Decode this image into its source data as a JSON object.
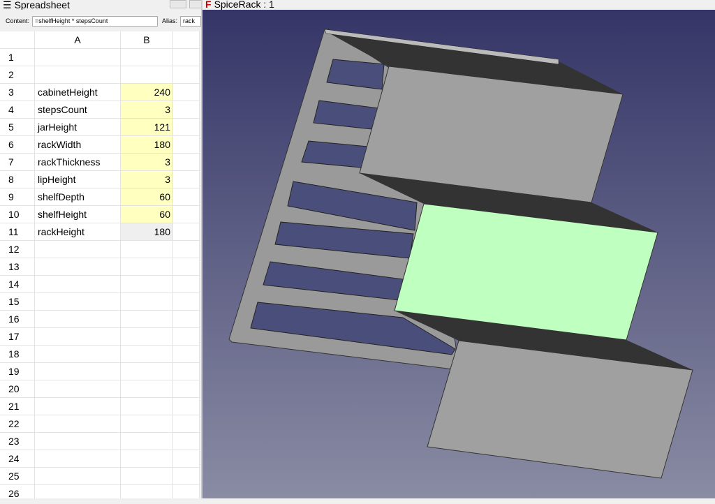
{
  "spreadsheet": {
    "title": "Spreadsheet",
    "content_label": "Content:",
    "content_value": "=shelfHeight * stepsCount",
    "alias_label": "Alias:",
    "alias_value": "rack",
    "columns": [
      "A",
      "B"
    ],
    "rows": [
      {
        "n": "1",
        "a": "",
        "b": ""
      },
      {
        "n": "2",
        "a": "",
        "b": ""
      },
      {
        "n": "3",
        "a": "cabinetHeight",
        "b": "240"
      },
      {
        "n": "4",
        "a": "stepsCount",
        "b": "3"
      },
      {
        "n": "5",
        "a": "jarHeight",
        "b": "121"
      },
      {
        "n": "6",
        "a": "rackWidth",
        "b": "180"
      },
      {
        "n": "7",
        "a": "rackThickness",
        "b": "3"
      },
      {
        "n": "8",
        "a": "lipHeight",
        "b": "3"
      },
      {
        "n": "9",
        "a": "shelfDepth",
        "b": "60"
      },
      {
        "n": "10",
        "a": "shelfHeight",
        "b": "60"
      },
      {
        "n": "11",
        "a": "rackHeight",
        "b": "180"
      },
      {
        "n": "12",
        "a": "",
        "b": ""
      },
      {
        "n": "13",
        "a": "",
        "b": ""
      },
      {
        "n": "14",
        "a": "",
        "b": ""
      },
      {
        "n": "15",
        "a": "",
        "b": ""
      },
      {
        "n": "16",
        "a": "",
        "b": ""
      },
      {
        "n": "17",
        "a": "",
        "b": ""
      },
      {
        "n": "18",
        "a": "",
        "b": ""
      },
      {
        "n": "19",
        "a": "",
        "b": ""
      },
      {
        "n": "20",
        "a": "",
        "b": ""
      },
      {
        "n": "21",
        "a": "",
        "b": ""
      },
      {
        "n": "22",
        "a": "",
        "b": ""
      },
      {
        "n": "23",
        "a": "",
        "b": ""
      },
      {
        "n": "24",
        "a": "",
        "b": ""
      },
      {
        "n": "25",
        "a": "",
        "b": ""
      },
      {
        "n": "26",
        "a": "",
        "b": ""
      }
    ],
    "alias_cell_color": "#ffffc0",
    "selected_cell_color": "#efefef"
  },
  "view": {
    "title": "SpiceRack : 1",
    "selected_face_color": "#bfffbf",
    "background_top": "#333366",
    "background_bottom": "#8a8ca4"
  }
}
